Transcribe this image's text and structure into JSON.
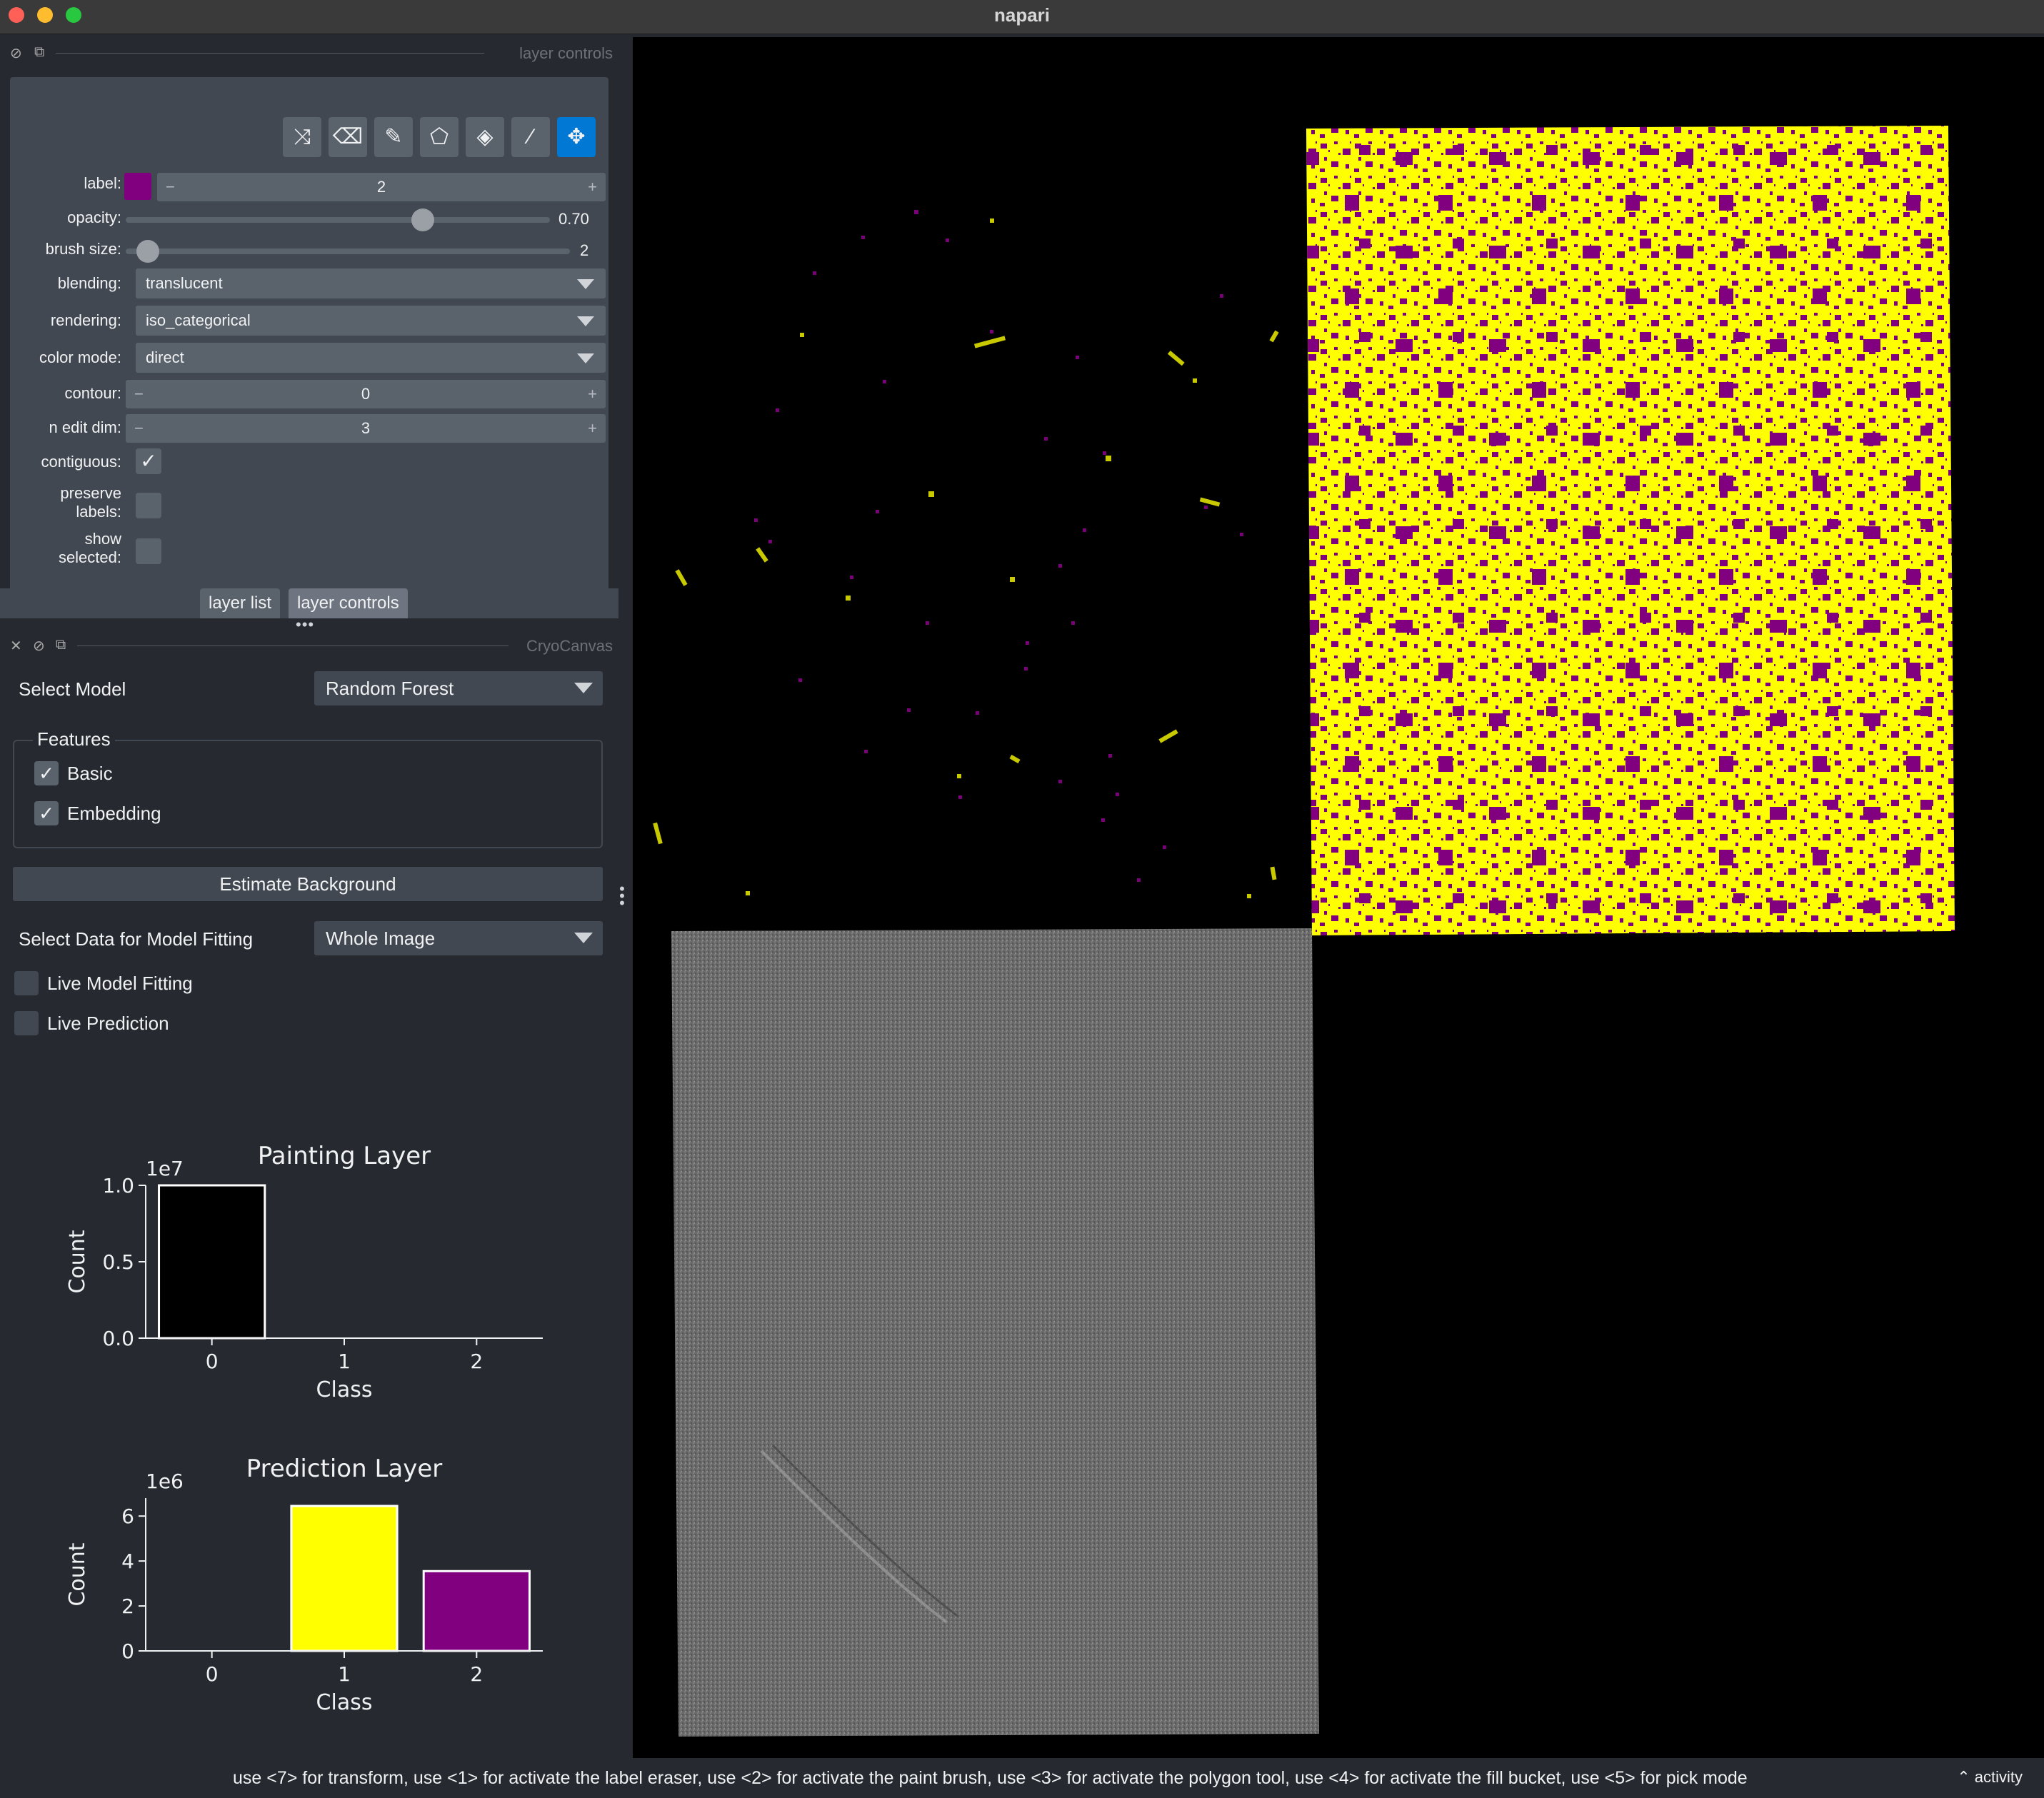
{
  "window": {
    "title": "napari"
  },
  "layer_controls": {
    "dock_title": "layer controls",
    "tools": [
      {
        "icon": "shuffle-icon",
        "active": false
      },
      {
        "icon": "eraser-icon",
        "active": false
      },
      {
        "icon": "paintbrush-icon",
        "active": false
      },
      {
        "icon": "polygon-icon",
        "active": false
      },
      {
        "icon": "fill-bucket-icon",
        "active": false
      },
      {
        "icon": "color-picker-icon",
        "active": false
      },
      {
        "icon": "move-icon",
        "active": true
      }
    ],
    "label": {
      "label": "label:",
      "value": "2",
      "color": "#800080"
    },
    "opacity": {
      "label": "opacity:",
      "value": "0.70",
      "fraction": 0.7
    },
    "brush_size": {
      "label": "brush size:",
      "value": "2",
      "fraction": 0.05
    },
    "blending": {
      "label": "blending:",
      "value": "translucent"
    },
    "rendering": {
      "label": "rendering:",
      "value": "iso_categorical"
    },
    "color_mode": {
      "label": "color mode:",
      "value": "direct"
    },
    "contour": {
      "label": "contour:",
      "value": "0"
    },
    "n_edit_dim": {
      "label": "n edit dim:",
      "value": "3"
    },
    "contiguous": {
      "label": "contiguous:",
      "checked": true
    },
    "preserve_labels": {
      "label_line1": "preserve",
      "label_line2": "labels:",
      "checked": false
    },
    "show_selected": {
      "label_line1": "show",
      "label_line2": "selected:",
      "checked": false
    }
  },
  "tabs": [
    {
      "label": "layer list",
      "active": false
    },
    {
      "label": "layer controls",
      "active": true
    }
  ],
  "cryocanvas": {
    "dock_title": "CryoCanvas",
    "select_model_label": "Select Model",
    "select_model_value": "Random Forest",
    "features_title": "Features",
    "feature_basic": "Basic",
    "feature_embedding": "Embedding",
    "estimate_background": "Estimate Background",
    "select_data_label": "Select Data for Model Fitting",
    "select_data_value": "Whole Image",
    "live_model_fitting": "Live Model Fitting",
    "live_prediction": "Live Prediction"
  },
  "chart_data": [
    {
      "type": "bar",
      "title": "Painting Layer",
      "xlabel": "Class",
      "ylabel": "Count",
      "offset_label": "1e7",
      "categories": [
        "0",
        "1",
        "2"
      ],
      "values": [
        10000000,
        0,
        0
      ],
      "colors": [
        "#000000",
        "#ffff00",
        "#800080"
      ],
      "ylim": [
        0,
        10000000
      ],
      "yticks": [
        0,
        5000000,
        10000000
      ],
      "ytick_labels": [
        "0.0",
        "0.5",
        "1.0"
      ]
    },
    {
      "type": "bar",
      "title": "Prediction Layer",
      "xlabel": "Class",
      "ylabel": "Count",
      "offset_label": "1e6",
      "categories": [
        "0",
        "1",
        "2"
      ],
      "values": [
        0,
        6450000,
        3550000
      ],
      "colors": [
        "#000000",
        "#ffff00",
        "#800080"
      ],
      "ylim": [
        0,
        6800000
      ],
      "yticks": [
        0,
        2000000,
        4000000,
        6000000
      ],
      "ytick_labels": [
        "0",
        "2",
        "4",
        "6"
      ]
    }
  ],
  "canvas": {
    "label_colors": {
      "class1": "#ffff00",
      "class2": "#800080",
      "background": "#000000",
      "tomogram": "#6b6b6b"
    }
  },
  "status": {
    "message": "use <7> for transform, use <1> for activate the label eraser, use <2> for activate the paint brush, use <3> for activate the polygon tool, use <4> for activate the fill bucket, use <5> for pick mode",
    "activity": "activity"
  }
}
